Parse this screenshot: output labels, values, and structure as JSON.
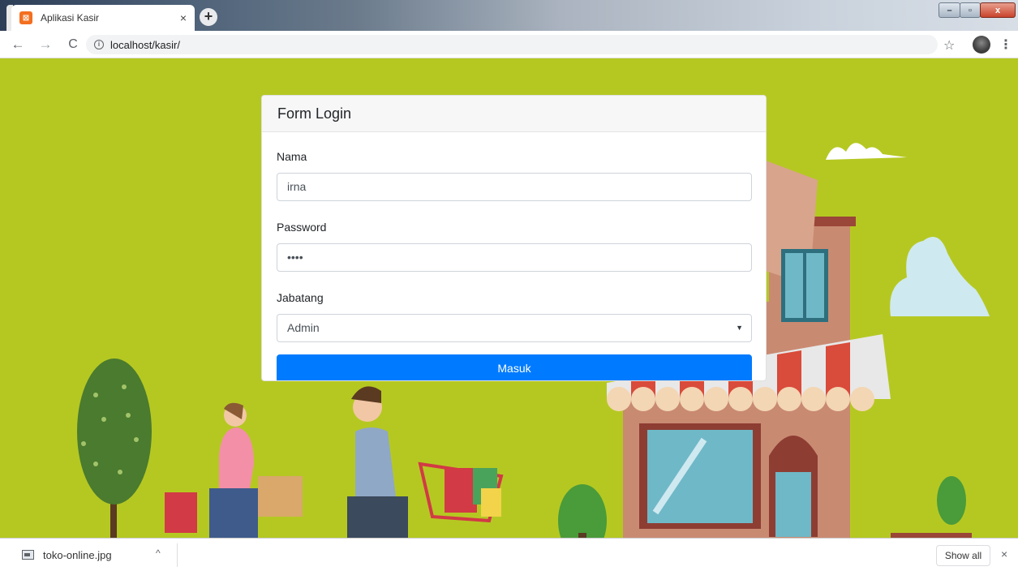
{
  "browser": {
    "tab_title": "Aplikasi Kasir",
    "tab_close": "×",
    "new_tab": "+",
    "url": "localhost/kasir/",
    "icons": {
      "favicon": "xampp-icon",
      "back": "arrow-left-icon",
      "forward": "arrow-right-icon",
      "reload": "reload-icon",
      "info": "info-icon",
      "bookmark": "star-icon",
      "profile": "profile-avatar",
      "menu": "kebab-menu-icon"
    }
  },
  "login": {
    "title": "Form Login",
    "nama_label": "Nama",
    "nama_value": "irna",
    "password_label": "Password",
    "password_value": "••••",
    "jabatan_label": "Jabatang",
    "jabatan_selected": "Admin",
    "submit_label": "Masuk"
  },
  "downloads": {
    "file_name": "toko-online.jpg",
    "show_all_label": "Show all",
    "close": "×"
  },
  "colors": {
    "page_background": "#b5c822",
    "primary_button": "#007bff",
    "card_header": "#f7f7f7"
  }
}
